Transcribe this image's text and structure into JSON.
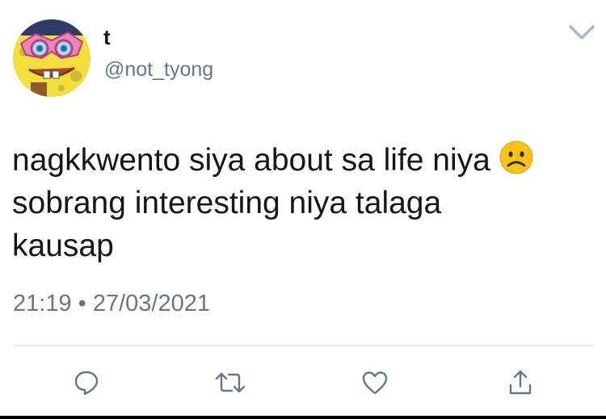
{
  "user": {
    "display_name": "t",
    "handle": "@not_tyong",
    "avatar_icon": "spongebob-avatar"
  },
  "tweet": {
    "lines": [
      "nagkkwento siya about sa life niya",
      "sobrang interesting niya talaga",
      "kausap"
    ],
    "emoji": "frowning-face",
    "timestamp": "21:19 • 27/03/2021"
  },
  "actions": {
    "reply_icon": "reply-icon",
    "retweet_icon": "retweet-icon",
    "like_icon": "heart-icon",
    "share_icon": "share-icon"
  },
  "colors": {
    "text": "#14171a",
    "secondary": "#657786",
    "divider": "#d9dfe3",
    "emoji_yellow": "#fcc21b"
  }
}
